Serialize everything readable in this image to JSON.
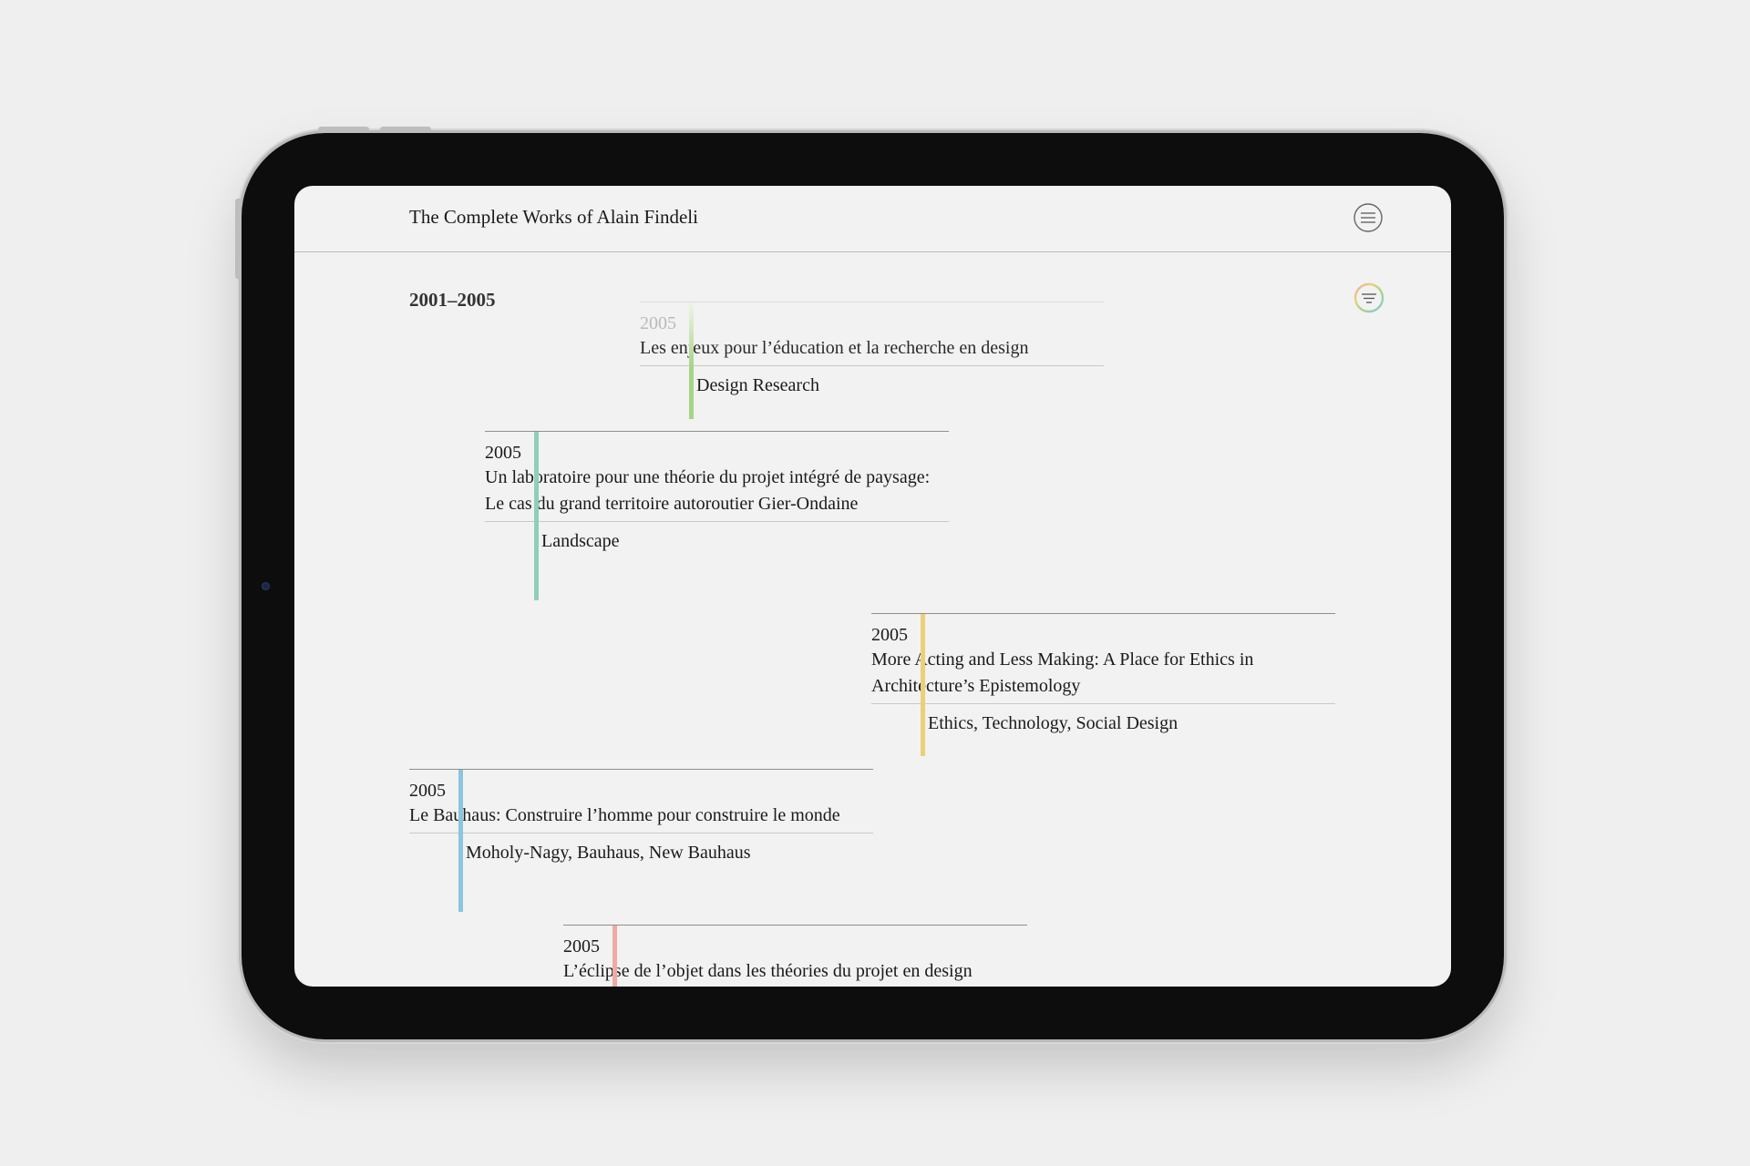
{
  "app": {
    "title": "The Complete Works of Alain Findeli"
  },
  "icons": {
    "menu": "hamburger-circle-icon",
    "filter": "filter-rainbow-circle-icon"
  },
  "section": {
    "range": "2001–2005"
  },
  "entries": [
    {
      "year": "2005",
      "title": "Les enjeux pour l’éducation et la recherche en design",
      "tags": "Design Research",
      "color": "#a8d48a"
    },
    {
      "year": "2005",
      "title": "Un laboratoire pour une théorie du projet intégré de paysage: Le cas du grand territoire autoroutier Gier-Ondaine",
      "tags": "Landscape",
      "color": "#8fcfb6"
    },
    {
      "year": "2005",
      "title": "More Acting and Less Making: A Place for Ethics in Architecture’s Epistemology",
      "tags": "Ethics, Technology, Social Design",
      "color": "#ead177"
    },
    {
      "year": "2005",
      "title": "Le Bauhaus: Construire l’homme pour construire le monde",
      "tags": "Moholy-Nagy, Bauhaus, New Bauhaus",
      "color": "#8cc6dc"
    },
    {
      "year": "2005",
      "title": "L’éclipse de l’objet dans les théories du projet en design",
      "tags": "",
      "color": "#eeaaa6"
    }
  ]
}
